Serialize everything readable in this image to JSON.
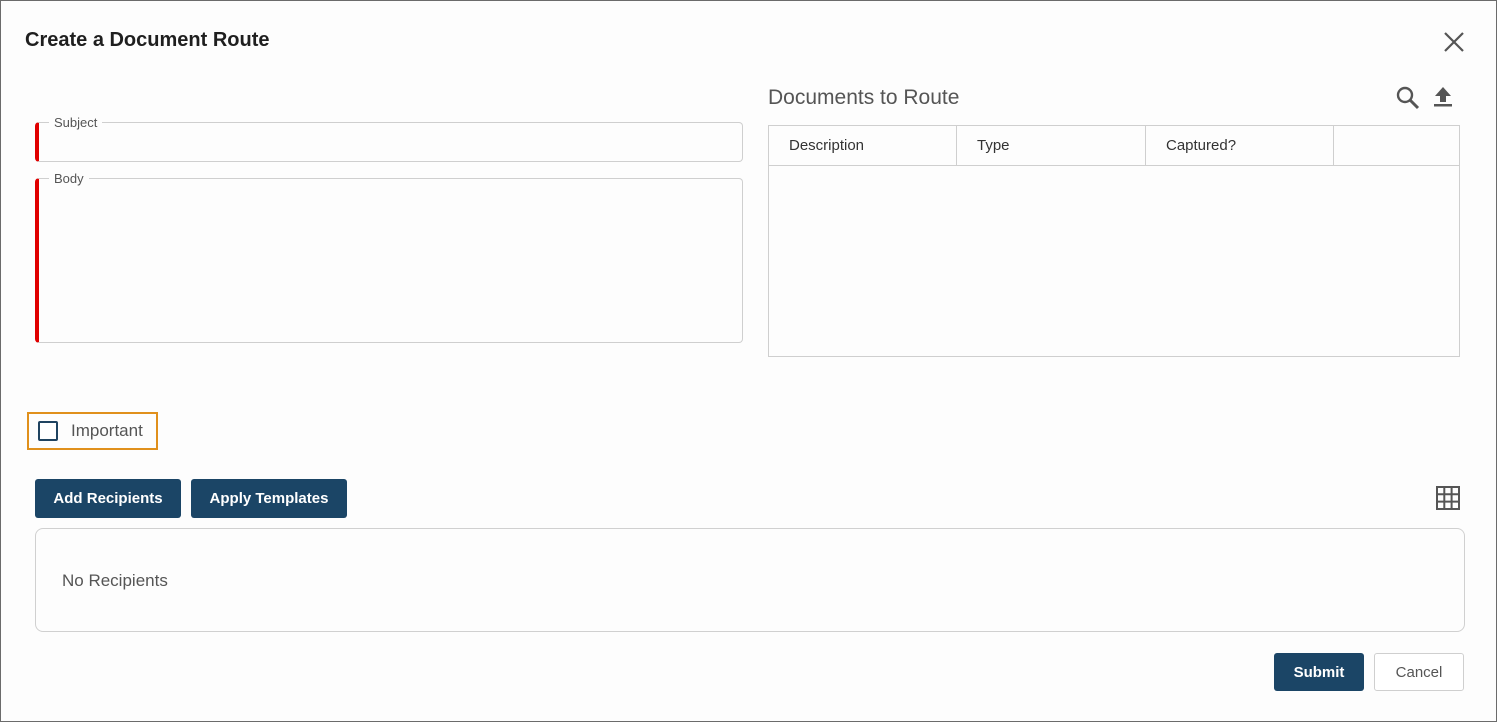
{
  "dialog": {
    "title": "Create a Document Route",
    "close_icon": "close-icon"
  },
  "form": {
    "subject_label": "Subject",
    "subject_value": "",
    "body_label": "Body",
    "body_value": "",
    "required_color": "#e00000"
  },
  "documents": {
    "title": "Documents to Route",
    "search_icon": "search-icon",
    "upload_icon": "upload-icon",
    "columns": [
      "Description",
      "Type",
      "Captured?",
      ""
    ],
    "rows": []
  },
  "important": {
    "label": "Important",
    "checked": false,
    "focus_color": "#e0901c"
  },
  "recipients": {
    "add_button": "Add Recipients",
    "apply_templates_button": "Apply Templates",
    "grid_icon": "grid-icon",
    "empty_text": "No Recipients"
  },
  "footer": {
    "submit": "Submit",
    "cancel": "Cancel"
  },
  "colors": {
    "primary": "#1b4566"
  }
}
